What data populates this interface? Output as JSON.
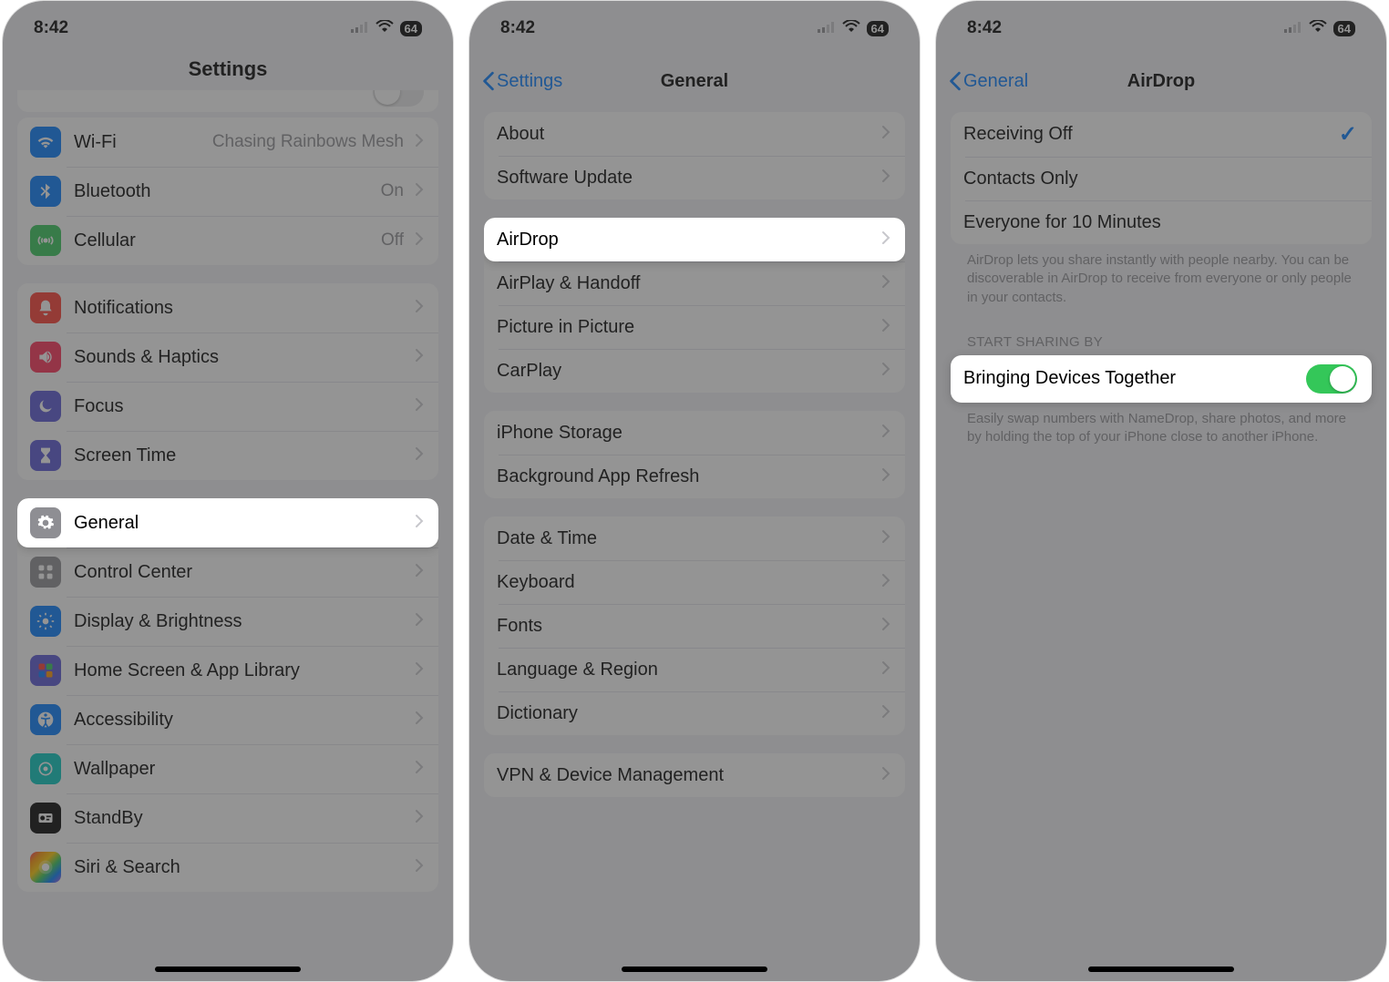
{
  "status": {
    "time": "8:42",
    "battery": "64"
  },
  "panel1": {
    "title": "Settings",
    "group1": [
      {
        "icon": "wifi-icon",
        "bg": "bg-blue",
        "label": "Wi-Fi",
        "value": "Chasing Rainbows Mesh"
      },
      {
        "icon": "bluetooth-icon",
        "bg": "bg-blue",
        "label": "Bluetooth",
        "value": "On"
      },
      {
        "icon": "cellular-icon",
        "bg": "bg-green",
        "label": "Cellular",
        "value": "Off"
      }
    ],
    "group2": [
      {
        "icon": "bell-icon",
        "bg": "bg-red",
        "label": "Notifications"
      },
      {
        "icon": "speaker-icon",
        "bg": "bg-pink",
        "label": "Sounds & Haptics"
      },
      {
        "icon": "moon-icon",
        "bg": "bg-indigo",
        "label": "Focus"
      },
      {
        "icon": "hourglass-icon",
        "bg": "bg-indigo",
        "label": "Screen Time"
      }
    ],
    "group3": [
      {
        "icon": "gear-icon",
        "bg": "bg-gray",
        "label": "General",
        "highlight": true
      },
      {
        "icon": "controlcenter-icon",
        "bg": "bg-gray",
        "label": "Control Center"
      },
      {
        "icon": "brightness-icon",
        "bg": "bg-blue",
        "label": "Display & Brightness"
      },
      {
        "icon": "grid-icon",
        "bg": "bg-indigo",
        "label": "Home Screen & App Library"
      },
      {
        "icon": "accessibility-icon",
        "bg": "bg-blue",
        "label": "Accessibility"
      },
      {
        "icon": "wallpaper-icon",
        "bg": "bg-cyan",
        "label": "Wallpaper"
      },
      {
        "icon": "standby-icon",
        "bg": "bg-black",
        "label": "StandBy"
      },
      {
        "icon": "siri-icon",
        "bg": "bg-multi",
        "label": "Siri & Search"
      }
    ]
  },
  "panel2": {
    "back": "Settings",
    "title": "General",
    "group1": [
      {
        "label": "About"
      },
      {
        "label": "Software Update"
      }
    ],
    "group2": [
      {
        "label": "AirDrop",
        "highlight": true
      },
      {
        "label": "AirPlay & Handoff"
      },
      {
        "label": "Picture in Picture"
      },
      {
        "label": "CarPlay"
      }
    ],
    "group3": [
      {
        "label": "iPhone Storage"
      },
      {
        "label": "Background App Refresh"
      }
    ],
    "group4": [
      {
        "label": "Date & Time"
      },
      {
        "label": "Keyboard"
      },
      {
        "label": "Fonts"
      },
      {
        "label": "Language & Region"
      },
      {
        "label": "Dictionary"
      }
    ],
    "group5": [
      {
        "label": "VPN & Device Management"
      }
    ]
  },
  "panel3": {
    "back": "General",
    "title": "AirDrop",
    "options": [
      {
        "label": "Receiving Off",
        "checked": true
      },
      {
        "label": "Contacts Only",
        "checked": false
      },
      {
        "label": "Everyone for 10 Minutes",
        "checked": false
      }
    ],
    "optionsFooter": "AirDrop lets you share instantly with people nearby. You can be discoverable in AirDrop to receive from everyone or only people in your contacts.",
    "sectionHeader": "START SHARING BY",
    "toggleRow": {
      "label": "Bringing Devices Together",
      "on": true
    },
    "toggleFooter": "Easily swap numbers with NameDrop, share photos, and more by holding the top of your iPhone close to another iPhone."
  }
}
